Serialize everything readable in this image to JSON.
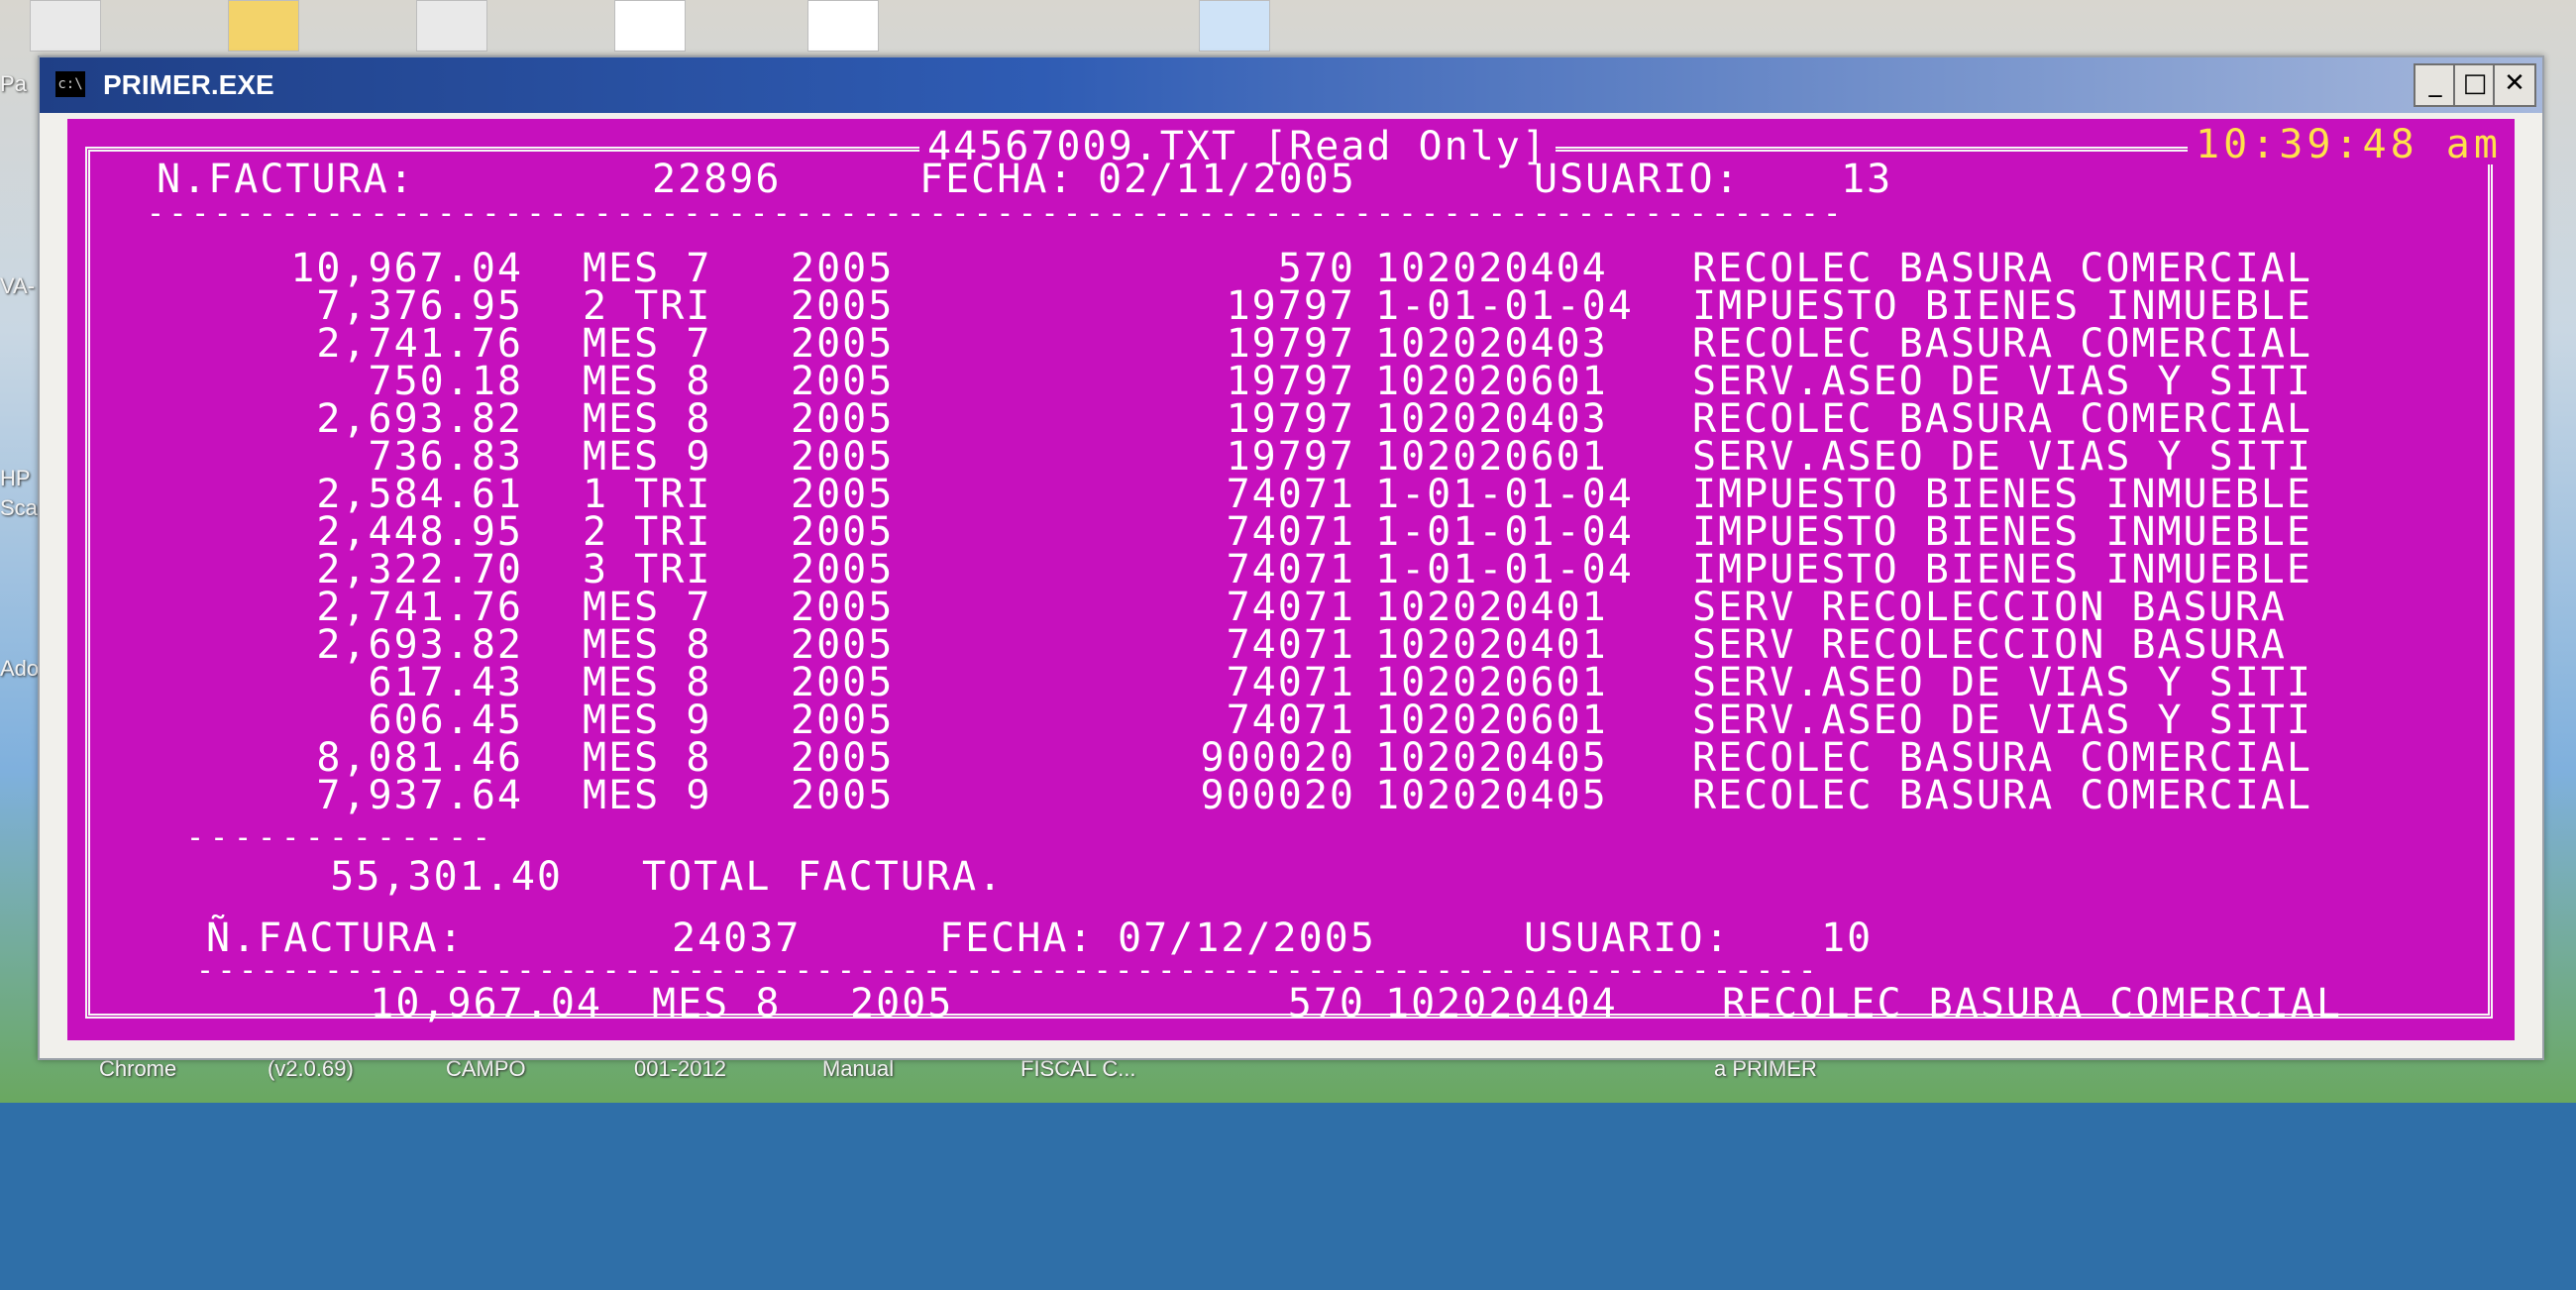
{
  "desktop": {
    "labels": [
      "Pa",
      "VA-",
      "HP",
      "Sca",
      "Ado",
      "Chrome",
      "(v2.0.69)",
      "CAMPO",
      "001-2012",
      "Manual",
      "FISCAL C...",
      "a PRIMER"
    ]
  },
  "window": {
    "title": "PRIMER.EXE",
    "icon_text": "c:\\",
    "minimize": "_",
    "maximize": "□",
    "close": "✕"
  },
  "console": {
    "file_header": "44567009.TXT [Read Only]",
    "clock": "10:39:48 am",
    "invoice1": {
      "label": "N.FACTURA:",
      "number": "22896",
      "date_label": "FECHA:",
      "date": "02/11/2005",
      "user_label": "USUARIO:",
      "user": "13"
    },
    "separator": "----------------------------------------------------------------------------",
    "rows": [
      {
        "amount": "10,967.04",
        "period": "MES 7",
        "year": "2005",
        "account": "570",
        "code": "102020404",
        "description": "RECOLEC BASURA COMERCIAL"
      },
      {
        "amount": "7,376.95",
        "period": "2 TRI",
        "year": "2005",
        "account": "19797",
        "code": "1-01-01-04",
        "description": "IMPUESTO BIENES INMUEBLE"
      },
      {
        "amount": "2,741.76",
        "period": "MES 7",
        "year": "2005",
        "account": "19797",
        "code": "102020403",
        "description": "RECOLEC BASURA COMERCIAL"
      },
      {
        "amount": "750.18",
        "period": "MES 8",
        "year": "2005",
        "account": "19797",
        "code": "102020601",
        "description": "SERV.ASEO DE VIAS Y SITI"
      },
      {
        "amount": "2,693.82",
        "period": "MES 8",
        "year": "2005",
        "account": "19797",
        "code": "102020403",
        "description": "RECOLEC BASURA COMERCIAL"
      },
      {
        "amount": "736.83",
        "period": "MES 9",
        "year": "2005",
        "account": "19797",
        "code": "102020601",
        "description": "SERV.ASEO DE VIAS Y SITI"
      },
      {
        "amount": "2,584.61",
        "period": "1 TRI",
        "year": "2005",
        "account": "74071",
        "code": "1-01-01-04",
        "description": "IMPUESTO BIENES INMUEBLE"
      },
      {
        "amount": "2,448.95",
        "period": "2 TRI",
        "year": "2005",
        "account": "74071",
        "code": "1-01-01-04",
        "description": "IMPUESTO BIENES INMUEBLE"
      },
      {
        "amount": "2,322.70",
        "period": "3 TRI",
        "year": "2005",
        "account": "74071",
        "code": "1-01-01-04",
        "description": "IMPUESTO BIENES INMUEBLE"
      },
      {
        "amount": "2,741.76",
        "period": "MES 7",
        "year": "2005",
        "account": "74071",
        "code": "102020401",
        "description": "SERV RECOLECCION BASURA"
      },
      {
        "amount": "2,693.82",
        "period": "MES 8",
        "year": "2005",
        "account": "74071",
        "code": "102020401",
        "description": "SERV RECOLECCION BASURA"
      },
      {
        "amount": "617.43",
        "period": "MES 8",
        "year": "2005",
        "account": "74071",
        "code": "102020601",
        "description": "SERV.ASEO DE VIAS Y SITI"
      },
      {
        "amount": "606.45",
        "period": "MES 9",
        "year": "2005",
        "account": "74071",
        "code": "102020601",
        "description": "SERV.ASEO DE VIAS Y SITI"
      },
      {
        "amount": "8,081.46",
        "period": "MES 8",
        "year": "2005",
        "account": "900020",
        "code": "102020405",
        "description": "RECOLEC BASURA COMERCIAL"
      },
      {
        "amount": "7,937.64",
        "period": "MES 9",
        "year": "2005",
        "account": "900020",
        "code": "102020405",
        "description": "RECOLEC BASURA COMERCIAL"
      }
    ],
    "total_separator": "-------------",
    "total_amount": "55,301.40",
    "total_label": "TOTAL FACTURA.",
    "invoice2": {
      "label": "Ñ.FACTURA:",
      "number": "24037",
      "date_label": "FECHA:",
      "date": "07/12/2005",
      "user_label": "USUARIO:",
      "user": "10"
    },
    "last_row": {
      "amount": "10,967.04",
      "period": "MES 8",
      "year": "2005",
      "account": "570",
      "code": "102020404",
      "description": "RECOLEC BASURA COMERCIAL"
    }
  }
}
